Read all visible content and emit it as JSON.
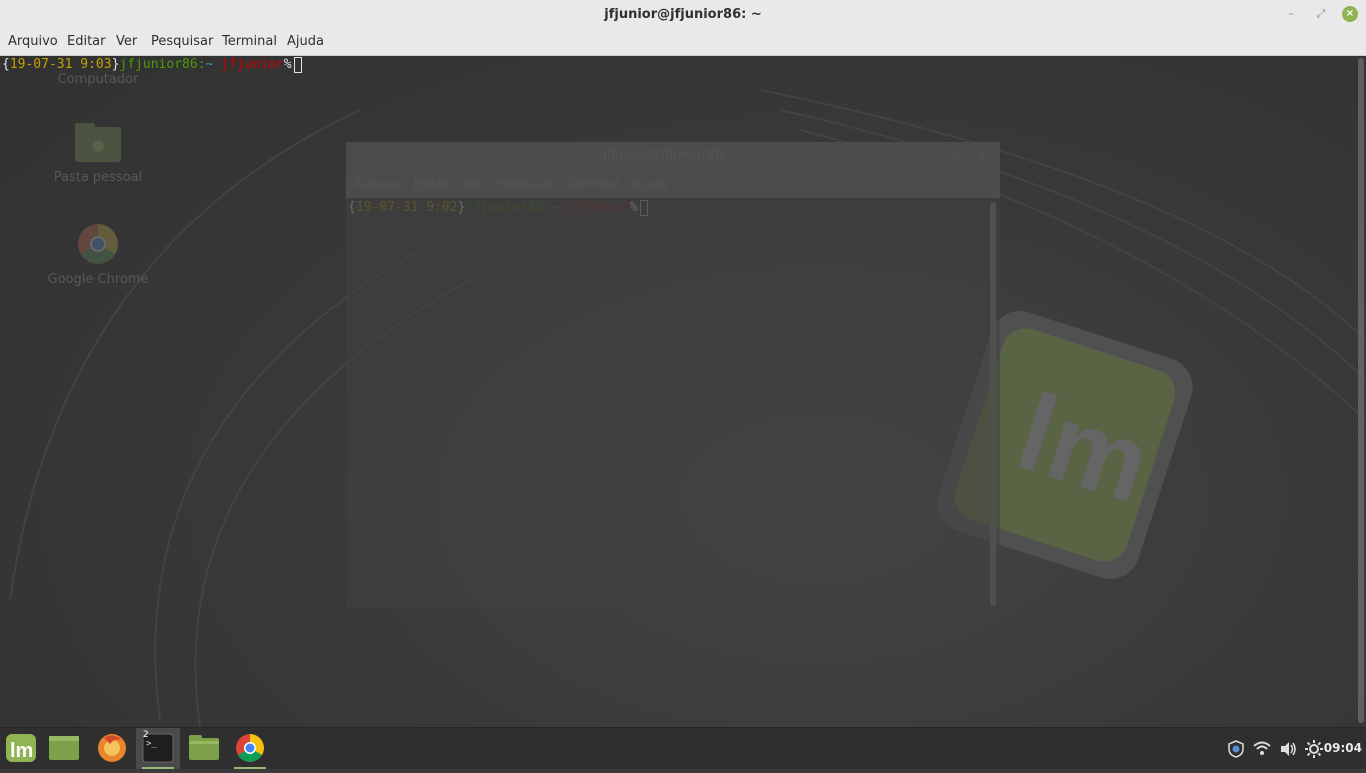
{
  "window": {
    "title": "jfjunior@jfjunior86: ~",
    "minimize_icon": "minimize-icon",
    "maximize_icon": "restore-icon",
    "close_icon": "close-icon",
    "close_symbol": "×",
    "minimize_symbol": "–",
    "maximize_symbol": "⤢"
  },
  "menubar": {
    "items": [
      "Arquivo",
      "Editar",
      "Ver",
      "Pesquisar",
      "Terminal",
      "Ajuda"
    ]
  },
  "terminal": {
    "prompt": {
      "open_brace": "{",
      "datetime": "19-07-31 9:03",
      "close_brace": "}",
      "user_host": "jfjunior86",
      "colon": ":",
      "path": "~",
      "space": " ",
      "user": "jfjunior",
      "symbol": "%",
      "colors": {
        "brace": "#e0e0e0",
        "datetime": "#c4a000",
        "user_host": "#4e9a06",
        "colon": "#4e9a06",
        "path": "#3d8fb0",
        "user": "#cc0000",
        "symbol": "#e0e0e0"
      }
    }
  },
  "ghost_window": {
    "title": "jfjunior@jfjunior86: ~",
    "menu": [
      "Arquivo",
      "Editar",
      "Ver",
      "Pesquisar",
      "Terminal",
      "Ajuda"
    ],
    "prompt": {
      "open_brace": "{",
      "datetime": "19-07-31 9:02",
      "close_brace": "}",
      "user_host": "jfjunior86",
      "colon": ":",
      "path": "~",
      "space": " ",
      "user": "jfjunior",
      "symbol": "%"
    }
  },
  "desktop": {
    "icons": [
      {
        "label": "Computador",
        "icon": "computer-icon"
      },
      {
        "label": "Pasta pessoal",
        "icon": "home-folder-icon"
      },
      {
        "label": "Google Chrome",
        "icon": "chrome-icon"
      }
    ]
  },
  "taskbar": {
    "launchers": [
      {
        "name": "mint-menu-icon"
      },
      {
        "name": "show-desktop-icon"
      },
      {
        "name": "firefox-icon"
      },
      {
        "name": "terminal-icon",
        "badge": "2"
      },
      {
        "name": "files-icon"
      },
      {
        "name": "chrome-icon"
      }
    ],
    "tray": [
      "update-shield-icon",
      "wifi-icon",
      "volume-icon",
      "brightness-icon"
    ],
    "clock": "09:04"
  },
  "colors": {
    "titlebar_bg": "#e9e9e9",
    "mint_green": "#8fb453",
    "taskbar_bg": "#2f2f2f"
  }
}
